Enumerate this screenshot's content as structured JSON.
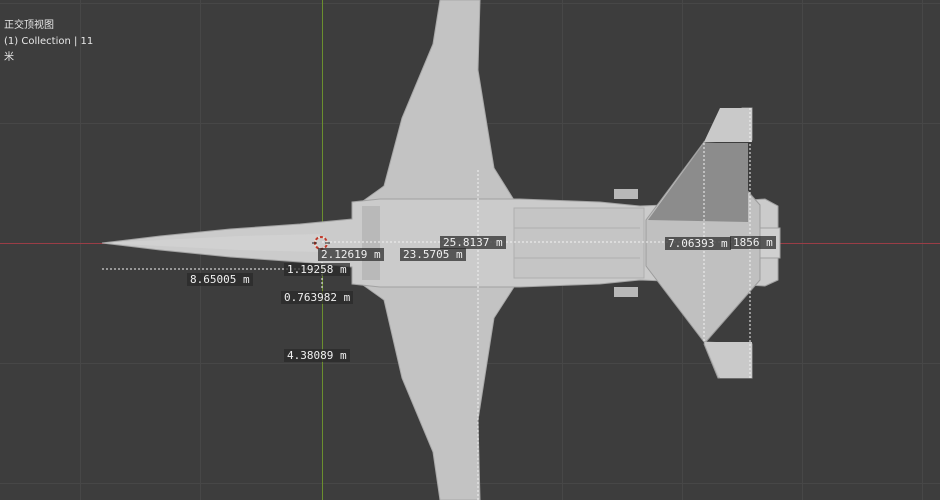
{
  "viewport": {
    "view_name": "正交顶视图",
    "collection_label": "(1) Collection | 11",
    "unit_label": "米"
  },
  "colors": {
    "background": "#3d3d3d",
    "grid": "#474747",
    "x_axis": "#9a3d46",
    "y_axis": "#6b8f2e",
    "mesh_light": "#c9c9c9",
    "mesh_dark": "#8f8f8f"
  },
  "measurements": {
    "m1": "25.8137 m",
    "m2": "7.06393 m",
    "m3": "1856 m",
    "m4": "2.12619 m",
    "m5": "23.5705 m",
    "m6": "1.19258 m",
    "m7": "8.65005 m",
    "m8": "0.763982 m",
    "m9": "4.38089 m"
  }
}
